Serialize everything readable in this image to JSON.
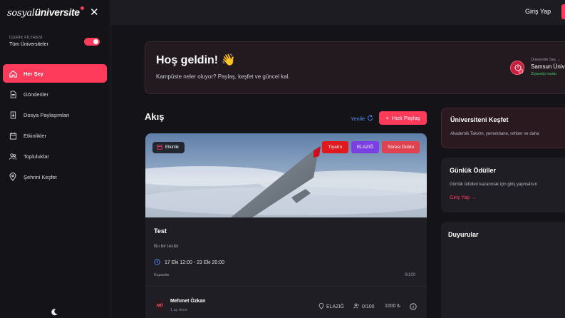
{
  "brand": {
    "logo_part1": "sosyal",
    "logo_part2": "üniversite"
  },
  "sidebar": {
    "filter_caption": "İÇERİK FİLTRESİ",
    "filter_value": "Tüm Üniversiteler",
    "filter_on": true,
    "items": [
      {
        "label": "Her Şey",
        "icon": "home-icon",
        "active": true
      },
      {
        "label": "Gönderiler",
        "icon": "document-icon",
        "active": false
      },
      {
        "label": "Dosya Paylaşımları",
        "icon": "file-share-icon",
        "active": false
      },
      {
        "label": "Etkinlikler",
        "icon": "calendar-icon",
        "active": false
      },
      {
        "label": "Topluluklar",
        "icon": "users-icon",
        "active": false
      },
      {
        "label": "Şehrini Keşfet",
        "icon": "location-pin-icon",
        "active": false
      }
    ]
  },
  "topbar": {
    "login": "Giriş Yap"
  },
  "welcome": {
    "title": "Hoş geldin! 👋",
    "subtitle": "Kampüste neler oluyor? Paylaş, keşfet ve güncel kal.",
    "uni_caption": "Üniversite Seç",
    "uni_name": "Samsun Üniv",
    "uni_mode": "Ziyaretçi modu"
  },
  "feed": {
    "title": "Akış",
    "refresh": "Yenile",
    "share": "Hızlı Paylaş"
  },
  "card": {
    "type_badge": "Etkinlik",
    "tags": [
      {
        "label": "Tiyatro",
        "color": "#e0191f"
      },
      {
        "label": "ELAZIĞ",
        "color": "#7b3fe4"
      },
      {
        "label": "Süresi Doldu",
        "color": "#e0434f"
      }
    ],
    "title": "Test",
    "description": "Bu bir testtir",
    "date": "17 Eki 12:00 - 23 Eki 20:00",
    "capacity_label": "Kapasite",
    "capacity_value": "0/100",
    "author_initials": "MÖ",
    "author": "Mehmet Özkan",
    "ago": "1 ay önce",
    "location": "ELAZIĞ",
    "attendees": "0/100",
    "price": "1000 ₺"
  },
  "right": {
    "discover_title": "Üniversiteni Keşfet",
    "discover_text": "Akademik Takvim, yemekhane, rehber ve daha",
    "rewards_title": "Günlük Ödüller",
    "rewards_text": "Günlük ödülleri kazanmak için giriş yapmalısın",
    "rewards_link": "Giriş Yap →",
    "announce_title": "Duyurular"
  },
  "colors": {
    "accent": "#ff3b5c",
    "bg": "#141418",
    "card": "#1e1e24",
    "link_blue": "#5b8cff",
    "green": "#3ccf6e"
  }
}
